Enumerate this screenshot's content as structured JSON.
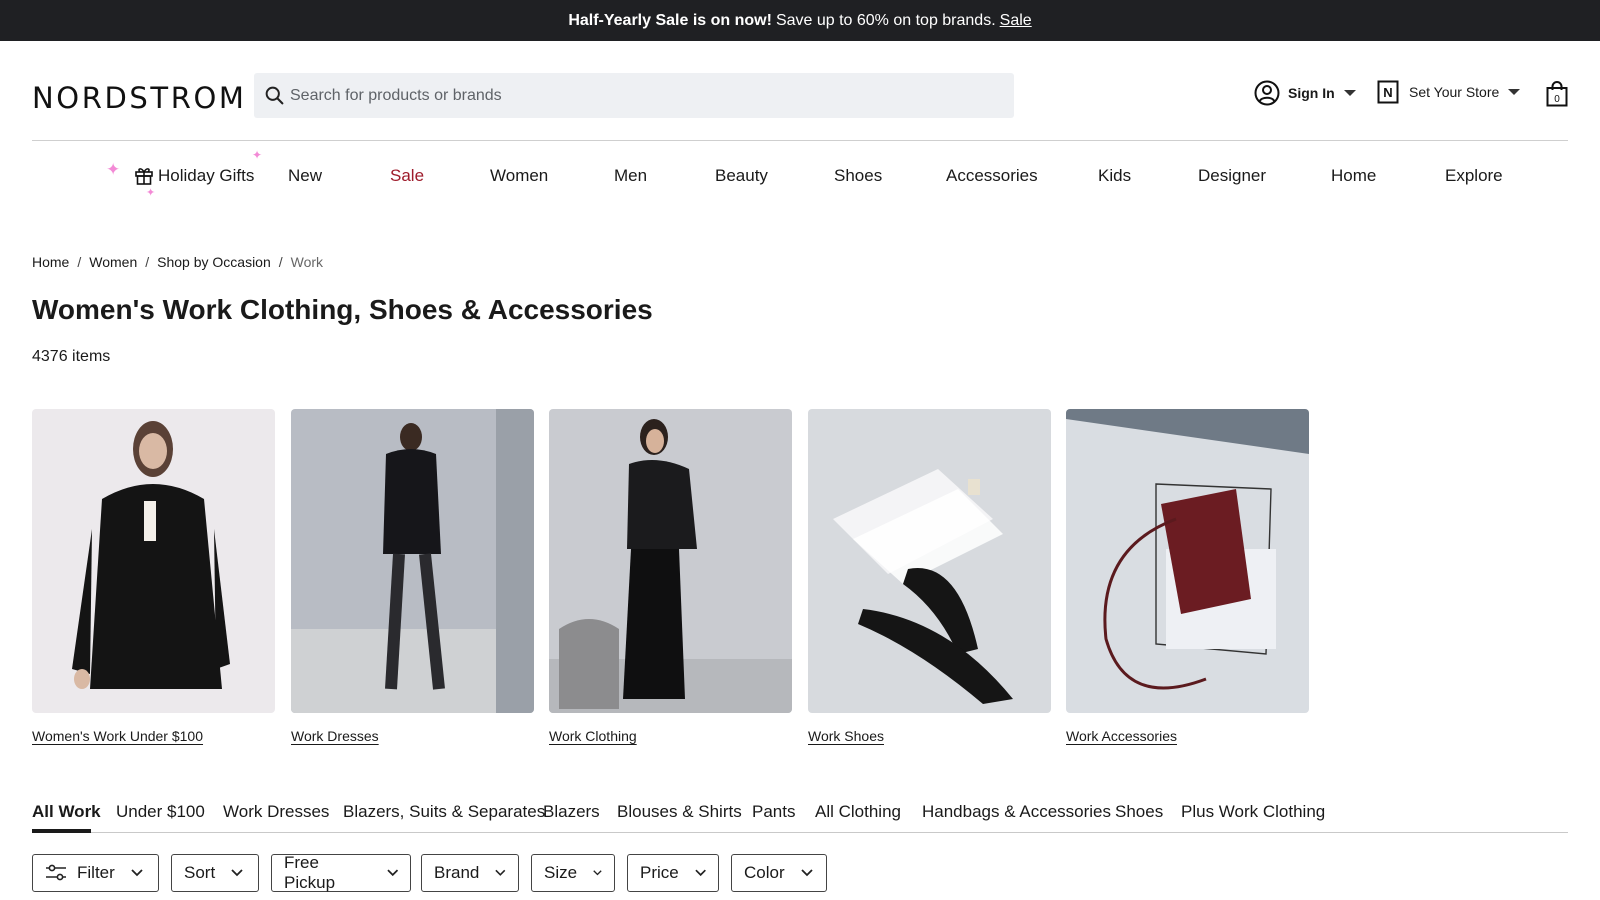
{
  "promo": {
    "bold": "Half-Yearly Sale is on now!",
    "text": "Save up to 60% on top brands.",
    "link": "Sale"
  },
  "header": {
    "logo": "NORDSTROM",
    "search_placeholder": "Search for products or brands",
    "signin": "Sign In",
    "store": "Set Your Store",
    "bag_count": "0"
  },
  "nav": {
    "items": [
      "Holiday Gifts",
      "New",
      "Sale",
      "Women",
      "Men",
      "Beauty",
      "Shoes",
      "Accessories",
      "Kids",
      "Designer",
      "Home",
      "Explore"
    ]
  },
  "breadcrumb": [
    "Home",
    "Women",
    "Shop by Occasion",
    "Work"
  ],
  "page": {
    "title": "Women's Work Clothing, Shoes & Accessories",
    "count": "4376 items"
  },
  "tiles": [
    "Women's Work Under $100",
    "Work Dresses",
    "Work Clothing",
    "Work Shoes",
    "Work Accessories"
  ],
  "tabs": [
    "All Work",
    "Under $100",
    "Work Dresses",
    "Blazers, Suits & Separates",
    "Blazers",
    "Blouses & Shirts",
    "Pants",
    "All Clothing",
    "Handbags & Accessories",
    "Shoes",
    "Plus Work Clothing"
  ],
  "filters": [
    "Filter",
    "Sort",
    "Free Pickup",
    "Brand",
    "Size",
    "Price",
    "Color"
  ],
  "colors": {
    "promo_bg": "#1f2023",
    "sale_red": "#9e1b2b",
    "search_bg": "#eef0f3",
    "sparkle": "#f38ad6"
  }
}
